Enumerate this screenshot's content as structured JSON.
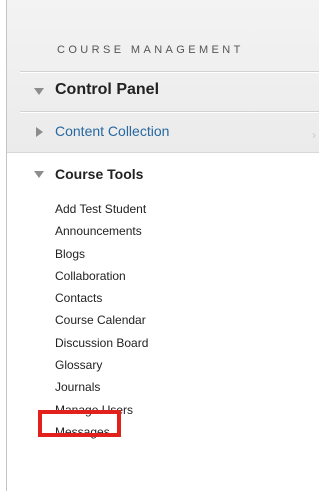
{
  "course_management": {
    "header": "COURSE MANAGEMENT",
    "control_panel_label": "Control Panel",
    "content_collection_label": "Content Collection",
    "content_collection_arrow": "›"
  },
  "course_tools": {
    "title": "Course Tools",
    "items": [
      "Add Test Student",
      "Announcements",
      "Blogs",
      "Collaboration",
      "Contacts",
      "Course Calendar",
      "Discussion Board",
      "Glossary",
      "Journals",
      "Manage Users",
      "Messages"
    ]
  },
  "highlighted_item": "Journals",
  "colors": {
    "highlight": "#e2211c",
    "link": "#26689f"
  }
}
